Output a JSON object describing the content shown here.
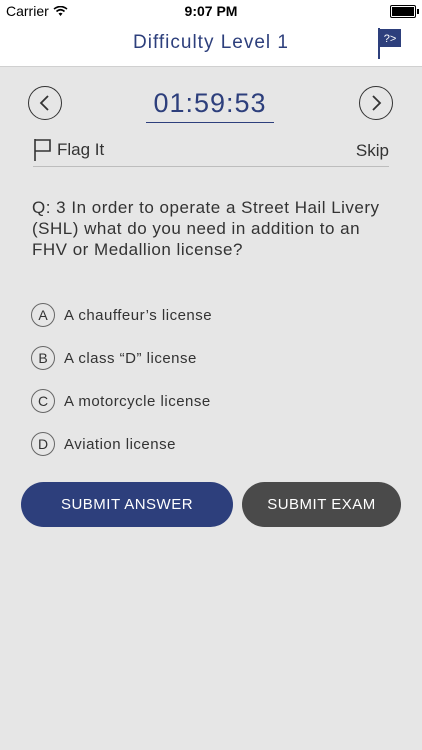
{
  "status_bar": {
    "carrier": "Carrier",
    "time": "9:07 PM"
  },
  "nav": {
    "title": "Difficulty Level 1",
    "flag_icon": "flag-question-icon"
  },
  "timer": {
    "value": "01:59:53"
  },
  "flag_row": {
    "flag_label": "Flag It",
    "skip_label": "Skip"
  },
  "question": {
    "text": "Q: 3 In order to operate a Street Hail Livery (SHL) what do you need in addition to an FHV or Medallion license?"
  },
  "options": [
    {
      "letter": "A",
      "label": "A chauffeur’s license"
    },
    {
      "letter": "B",
      "label": "A class “D” license"
    },
    {
      "letter": "C",
      "label": "A motorcycle license"
    },
    {
      "letter": "D",
      "label": "Aviation license"
    }
  ],
  "buttons": {
    "submit_answer": "SUBMIT ANSWER",
    "submit_exam": "SUBMIT EXAM"
  },
  "colors": {
    "primary": "#2d3f7c",
    "secondary": "#4a4a4a",
    "background": "#e6e6e6"
  }
}
